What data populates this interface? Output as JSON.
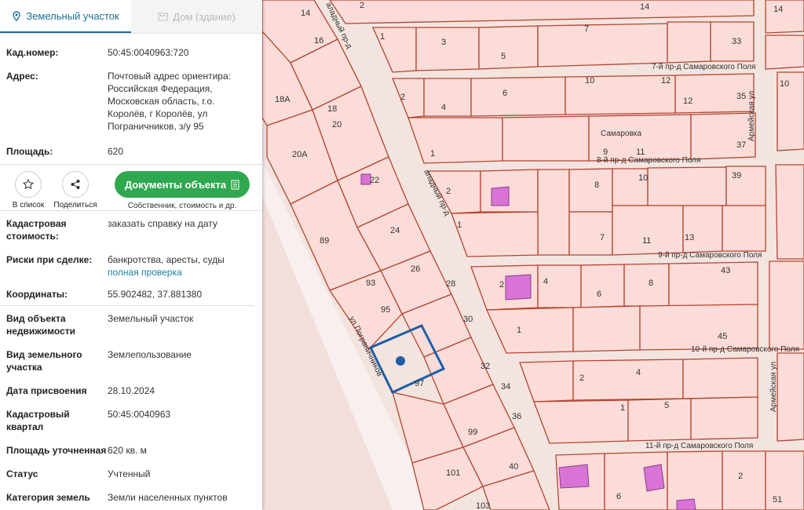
{
  "tabs": {
    "land": "Земельный участок",
    "house": "Дом (здание)"
  },
  "fields": {
    "cad_label": "Кад.номер:",
    "cad_value": "50:45:0040963:720",
    "addr_label": "Адрес:",
    "addr_value": "Почтовый адрес ориентира: Российская Федерация, Московская область, г.о. Королёв, г Королёв, ул Пограничников, з/у 95",
    "area_label": "Площадь:",
    "area_value": "620"
  },
  "actions": {
    "list": "В список",
    "share": "Поделиться",
    "docs_button": "Документы объекта",
    "docs_sub": "Собственник, стоимость и др."
  },
  "details": {
    "cost_label": "Кадастровая стоимость:",
    "cost_link": "заказать справку на дату",
    "risks_label": "Риски при сделке:",
    "risks_value": "банкротства, аресты, суды",
    "risks_link": "полная проверка",
    "coords_label": "Координаты:",
    "coords_value": "55.902482, 37.881380",
    "obj_type_label": "Вид объекта недвижимости",
    "obj_type_value": "Земельный участок",
    "land_use_label": "Вид земельного участка",
    "land_use_value": "Землепользование",
    "date_label": "Дата присвоения",
    "date_value": "28.10.2024",
    "quarter_label": "Кадастровый квартал",
    "quarter_value": "50:45:0040963",
    "area_ref_label": "Площадь уточненная",
    "area_ref_value": "620 кв. м",
    "status_label": "Статус",
    "status_value": "Учтенный",
    "category_label": "Категория земель",
    "category_value": "Земли населенных пунктов"
  },
  "map": {
    "streets": {
      "s7": "7-й пр-д Самаровского Поля",
      "s8": "8-й пр-д Самаровского Поля",
      "s9": "9-й пр-д Самаровского Поля",
      "s10": "10-й пр-д Самаровского Поля",
      "s11": "11-й пр-д Самаровского Поля",
      "armeyskaya": "Армейская ул",
      "pogr": "ул Пограничников",
      "zap_top": "аладный пр-д",
      "zap_mid": "ападный пр-д",
      "samarovka": "Самаровка"
    },
    "lot_numbers": [
      "14",
      "16",
      "18",
      "20",
      "18А",
      "20А",
      "22",
      "24",
      "26",
      "28",
      "30",
      "32",
      "34",
      "36",
      "89",
      "93",
      "95",
      "97",
      "99",
      "101",
      "103",
      "40",
      "2",
      "1",
      "3",
      "5",
      "7",
      "4",
      "6",
      "12",
      "33",
      "35",
      "37",
      "9",
      "11",
      "10",
      "8",
      "13",
      "39",
      "43",
      "45",
      "51"
    ],
    "colors": {
      "plot_fill": "#fbdcd8",
      "plot_border": "#b4452f",
      "building": "#d973d6",
      "selected": "#1f5ea8"
    }
  }
}
